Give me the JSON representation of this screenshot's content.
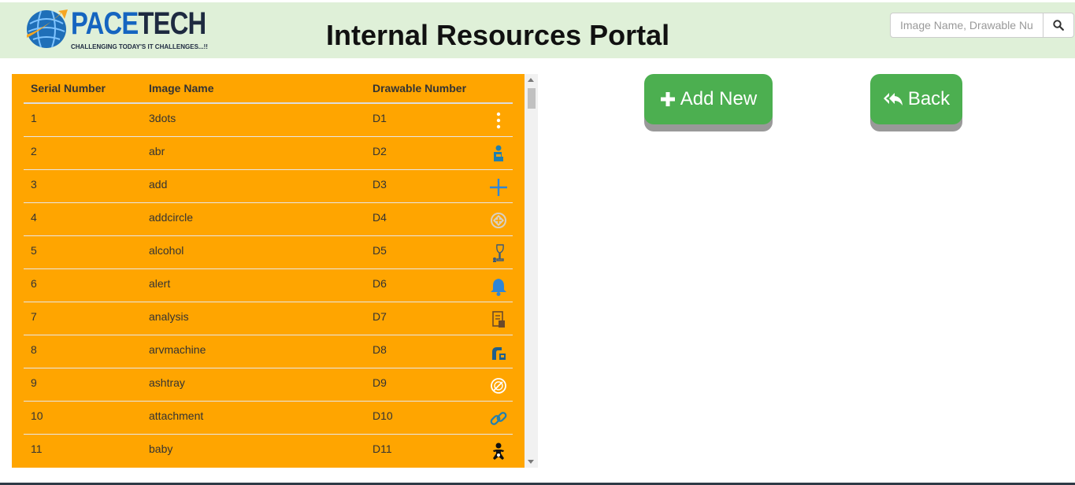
{
  "header": {
    "logo": {
      "brand_part1": "PACE",
      "brand_part2": "TECH",
      "tagline": "CHALLENGING TODAY'S IT CHALLENGES...!!"
    },
    "title": "Internal Resources Portal",
    "search": {
      "placeholder": "Image Name, Drawable Number",
      "icon": "search-icon"
    }
  },
  "table": {
    "columns": [
      "Serial Number",
      "Image Name",
      "Drawable Number"
    ],
    "rows": [
      {
        "serial": "1",
        "name": "3dots",
        "drawable": "D1",
        "icon": "three-dots-icon",
        "color": "#ffffff"
      },
      {
        "serial": "2",
        "name": "abr",
        "drawable": "D2",
        "icon": "person-sitting-icon",
        "color": "#1f7fb0"
      },
      {
        "serial": "3",
        "name": "add",
        "drawable": "D3",
        "icon": "plus-icon",
        "color": "#2f86d6"
      },
      {
        "serial": "4",
        "name": "addcircle",
        "drawable": "D4",
        "icon": "add-circle-icon",
        "color": "#d9d0c0"
      },
      {
        "serial": "5",
        "name": "alcohol",
        "drawable": "D5",
        "icon": "wine-glass-icon",
        "color": "#3a5a7a"
      },
      {
        "serial": "6",
        "name": "alert",
        "drawable": "D6",
        "icon": "bell-icon",
        "color": "#2f86d6"
      },
      {
        "serial": "7",
        "name": "analysis",
        "drawable": "D7",
        "icon": "document-analysis-icon",
        "color": "#6b4a2a"
      },
      {
        "serial": "8",
        "name": "arvmachine",
        "drawable": "D8",
        "icon": "machine-icon",
        "color": "#1f5f8b"
      },
      {
        "serial": "9",
        "name": "ashtray",
        "drawable": "D9",
        "icon": "ashtray-icon",
        "color": "#ffffff"
      },
      {
        "serial": "10",
        "name": "attachment",
        "drawable": "D10",
        "icon": "link-icon",
        "color": "#1f7fb0"
      },
      {
        "serial": "11",
        "name": "baby",
        "drawable": "D11",
        "icon": "baby-icon",
        "color": "#111111"
      }
    ]
  },
  "buttons": {
    "add_new": {
      "label": "Add New",
      "icon": "plus-icon"
    },
    "back": {
      "label": "Back",
      "icon": "reply-all-icon"
    }
  },
  "colors": {
    "header_bg": "#dff0d8",
    "table_bg": "#ffa500",
    "button_bg": "#4caf50",
    "button_shadow": "#999999"
  }
}
